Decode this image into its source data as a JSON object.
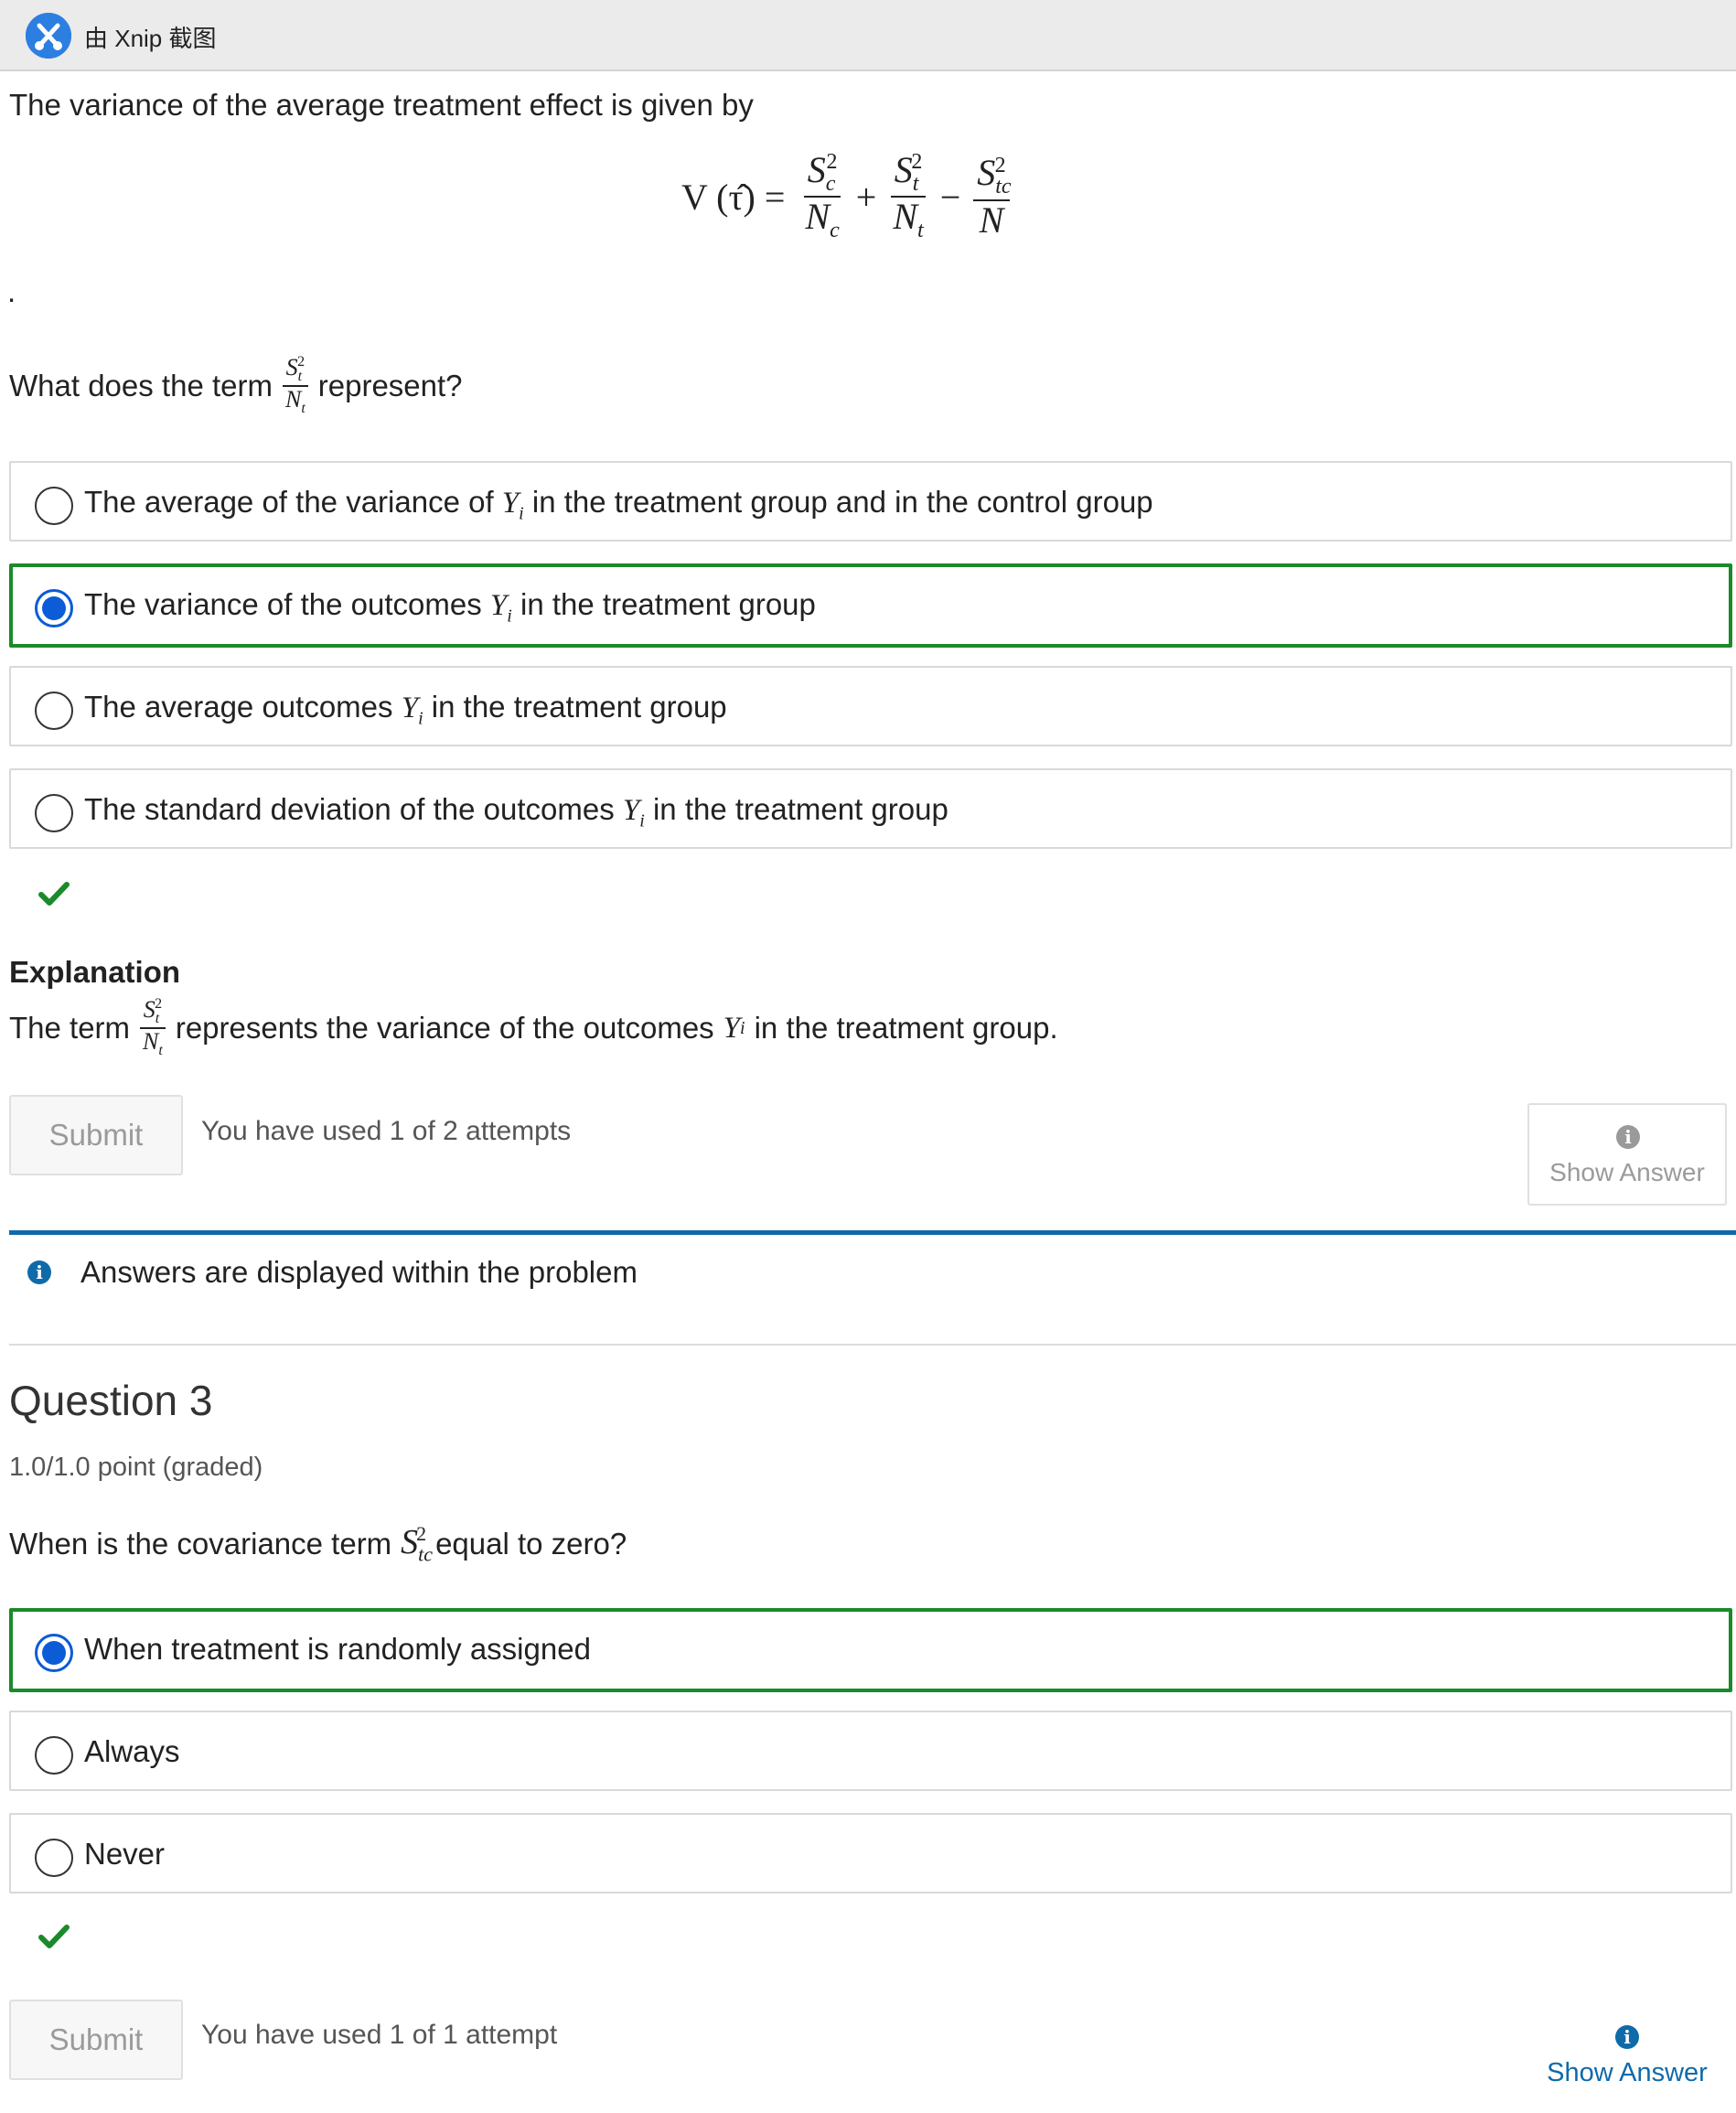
{
  "topbar": {
    "app_label": "由 Xnip 截图"
  },
  "intro": {
    "text": "The variance of the average treatment effect is given by",
    "period": "."
  },
  "formula": {
    "lhs": "V (τ̂) =",
    "term1": {
      "num": "S",
      "num_sub": "c",
      "num_sup": "2",
      "den": "N",
      "den_sub": "c"
    },
    "op1": "+",
    "term2": {
      "num": "S",
      "num_sub": "t",
      "num_sup": "2",
      "den": "N",
      "den_sub": "t"
    },
    "op2": "−",
    "term3": {
      "num": "S",
      "num_sub": "tc",
      "num_sup": "2",
      "den": "N"
    }
  },
  "question2": {
    "prompt_before": "What does the term",
    "prompt_after": "represent?",
    "options": [
      {
        "before": "The average of the variance of",
        "var": "Y",
        "sub": "i",
        "after": "in the treatment group and in the control group",
        "selected": false
      },
      {
        "before": "The variance of the outcomes",
        "var": "Y",
        "sub": "i",
        "after": "in the treatment group",
        "selected": true
      },
      {
        "before": "The average outcomes",
        "var": "Y",
        "sub": "i",
        "after": "in the treatment group",
        "selected": false
      },
      {
        "before": "The standard deviation of the outcomes",
        "var": "Y",
        "sub": "i",
        "after": "in the treatment group",
        "selected": false
      }
    ],
    "explanation_title": "Explanation",
    "explanation_before": "The term",
    "explanation_after": "represents the variance of the outcomes",
    "explanation_var": "Y",
    "explanation_sub": "i",
    "explanation_end": "in the treatment group.",
    "submit_label": "Submit",
    "attempts": "You have used 1 of 2 attempts",
    "show_answer": "Show Answer"
  },
  "notice": {
    "text": "Answers are displayed within the problem"
  },
  "question3": {
    "title": "Question 3",
    "points": "1.0/1.0 point (graded)",
    "prompt_before": "When is the covariance term",
    "prompt_after": "equal to zero?",
    "options": [
      {
        "label": "When treatment is randomly assigned",
        "selected": true
      },
      {
        "label": "Always",
        "selected": false
      },
      {
        "label": "Never",
        "selected": false
      }
    ],
    "submit_label": "Submit",
    "attempts": "You have used 1 of 1 attempt",
    "show_answer": "Show Answer"
  },
  "colors": {
    "correct_green": "#1b8a2a",
    "radio_blue": "#0b5cd6",
    "link_blue": "#0f6aaa"
  }
}
